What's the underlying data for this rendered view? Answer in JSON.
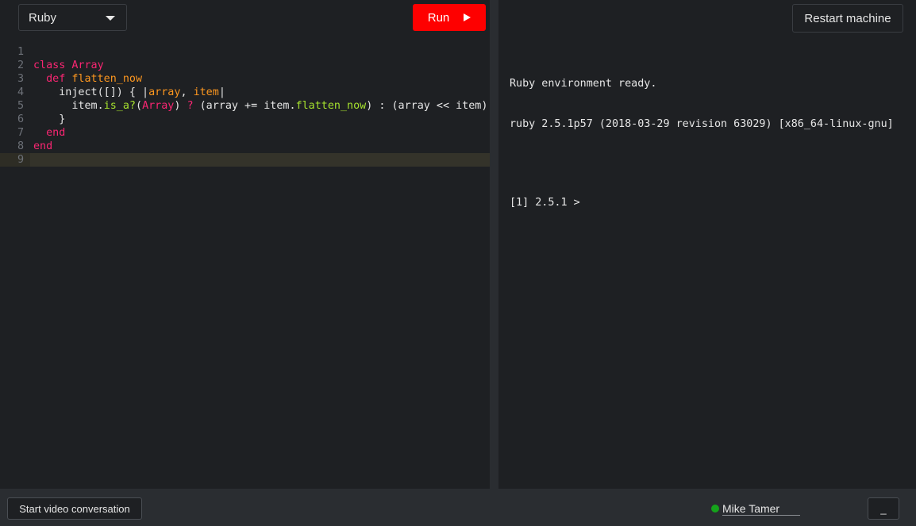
{
  "language_select": {
    "value": "Ruby"
  },
  "toolbar": {
    "run_label": "Run",
    "restart_label": "Restart machine"
  },
  "editor": {
    "active_line": 9,
    "lines": [
      {
        "num": "1",
        "tokens": []
      },
      {
        "num": "2",
        "tokens": [
          {
            "t": "kw",
            "v": "class "
          },
          {
            "t": "cls",
            "v": "Array"
          }
        ]
      },
      {
        "num": "3",
        "tokens": [
          {
            "t": "pl",
            "v": "  "
          },
          {
            "t": "kw",
            "v": "def "
          },
          {
            "t": "fn",
            "v": "flatten_now"
          }
        ]
      },
      {
        "num": "4",
        "tokens": [
          {
            "t": "pl",
            "v": "    inject([]) { |"
          },
          {
            "t": "arg",
            "v": "array"
          },
          {
            "t": "pl",
            "v": ", "
          },
          {
            "t": "arg",
            "v": "item"
          },
          {
            "t": "pl",
            "v": "|"
          }
        ]
      },
      {
        "num": "5",
        "tokens": [
          {
            "t": "pl",
            "v": "      item."
          },
          {
            "t": "meth",
            "v": "is_a?"
          },
          {
            "t": "pl",
            "v": "("
          },
          {
            "t": "cls",
            "v": "Array"
          },
          {
            "t": "pl",
            "v": ") "
          },
          {
            "t": "kw",
            "v": "?"
          },
          {
            "t": "pl",
            "v": " (array += item."
          },
          {
            "t": "meth",
            "v": "flatten_now"
          },
          {
            "t": "pl",
            "v": ") : (array << item)"
          }
        ]
      },
      {
        "num": "6",
        "tokens": [
          {
            "t": "pl",
            "v": "    }"
          }
        ]
      },
      {
        "num": "7",
        "tokens": [
          {
            "t": "pl",
            "v": "  "
          },
          {
            "t": "kw",
            "v": "end"
          }
        ]
      },
      {
        "num": "8",
        "tokens": [
          {
            "t": "kw",
            "v": "end"
          }
        ]
      },
      {
        "num": "9",
        "tokens": []
      }
    ]
  },
  "terminal": {
    "line1": "Ruby environment ready.",
    "line2": "ruby 2.5.1p57 (2018-03-29 revision 63029) [x86_64-linux-gnu]",
    "prompt": "[1] 2.5.1 >"
  },
  "bottom_bar": {
    "video_label": "Start video conversation",
    "user_name": "Mike Tamer",
    "minimize_label": "_",
    "status_color": "#15a31b"
  },
  "colors": {
    "run_button": "#fe0000",
    "background": "#1e2023",
    "keyword": "#f92672",
    "function_name": "#fd971f",
    "method": "#a6e22e"
  }
}
